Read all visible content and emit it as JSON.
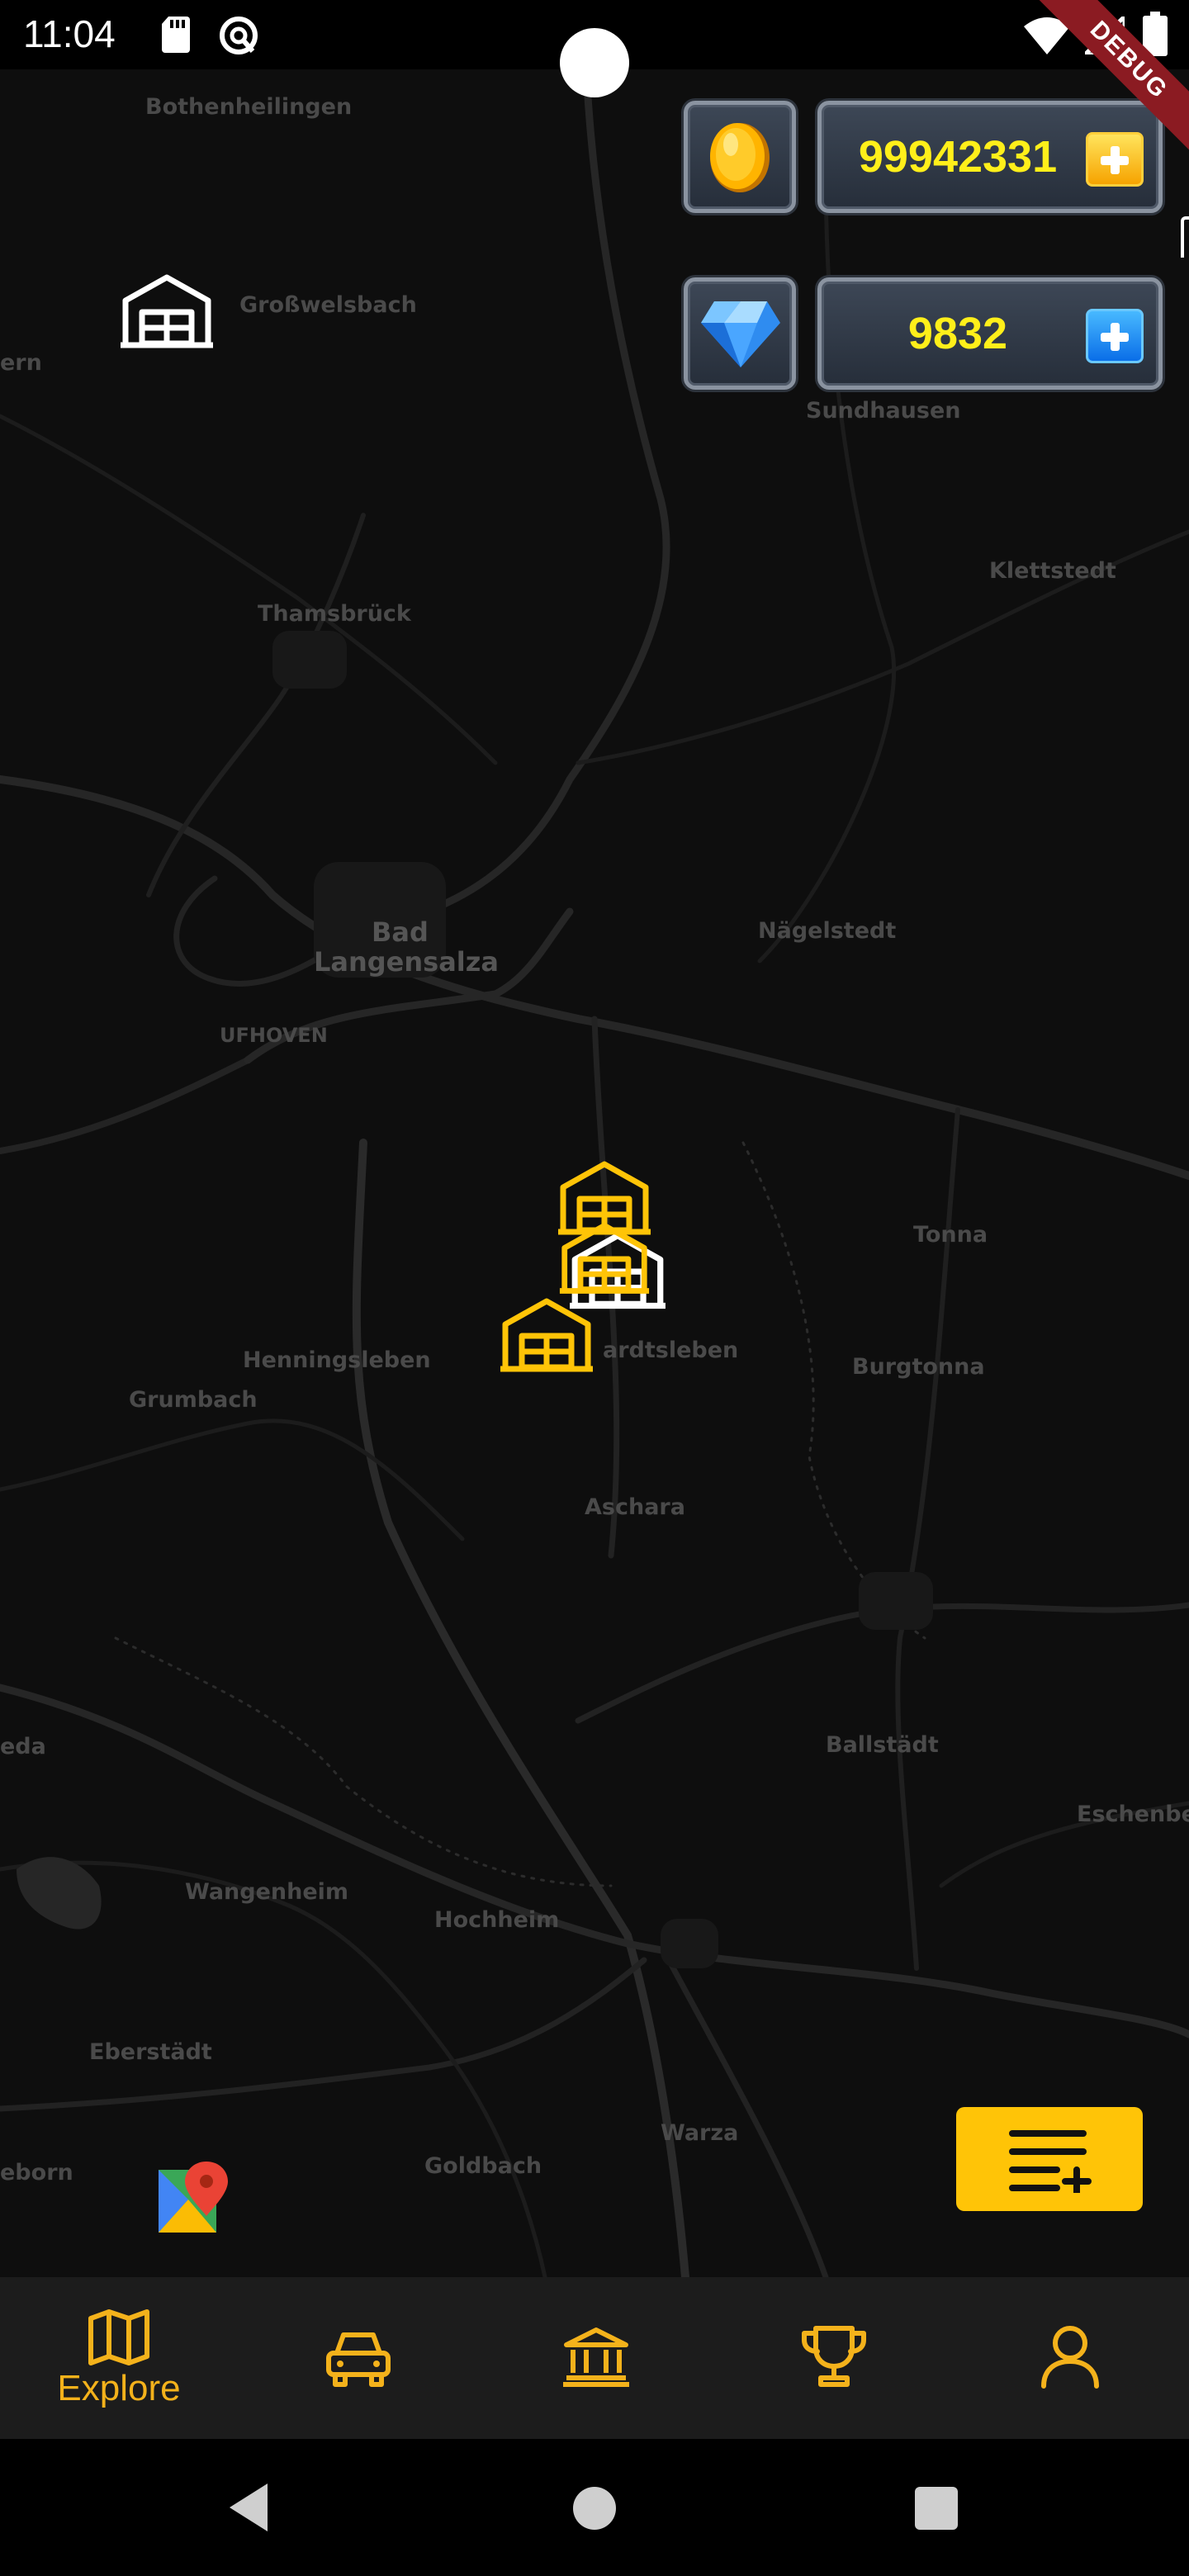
{
  "status_bar": {
    "time": "11:04",
    "debug_label": "DEBUG",
    "icons": [
      "sd-card-icon",
      "notification-sync-icon",
      "wifi-icon",
      "signal-icon",
      "battery-icon"
    ]
  },
  "currency": {
    "coins": {
      "value": "99942331",
      "icon": "gold-coin-icon",
      "add_icon": "plus-icon",
      "accent": "#ffef1a"
    },
    "gems": {
      "value": "9832",
      "icon": "blue-diamond-icon",
      "add_icon": "plus-icon"
    }
  },
  "map": {
    "places": [
      "Bothenheilingen",
      "Großwelsbach",
      "Sundhausen",
      "Klettstedt",
      "Thamsbrück",
      "Bad",
      "Langensalza",
      "UFHOVEN",
      "Nägelstedt",
      "Tonna",
      "Henningsleben",
      "ardtsleben",
      "Burgtonna",
      "Grumbach",
      "Aschara",
      "eda",
      "Ballstädt",
      "Eschenbe",
      "Wangenheim",
      "Hochheim",
      "Eberstädt",
      "Warza",
      "Goldbach",
      "eborn",
      "ern"
    ],
    "markers": {
      "white_garage": "garage-icon",
      "yellow_garages": "garage-icon",
      "accent_color": "#ffc407"
    }
  },
  "controls": {
    "maps_logo_icon": "google-maps-icon",
    "list_add_icon": "playlist-add-icon",
    "list_add_color": "#ffc407"
  },
  "bottom_nav": {
    "accent": "#f4b21b",
    "items": [
      {
        "label": "Explore",
        "icon": "map-icon"
      },
      {
        "label": "",
        "icon": "car-icon"
      },
      {
        "label": "",
        "icon": "bank-icon"
      },
      {
        "label": "",
        "icon": "trophy-icon"
      },
      {
        "label": "",
        "icon": "user-icon"
      }
    ]
  },
  "system_nav": {
    "icons": [
      "back-icon",
      "home-icon",
      "recents-icon"
    ]
  }
}
